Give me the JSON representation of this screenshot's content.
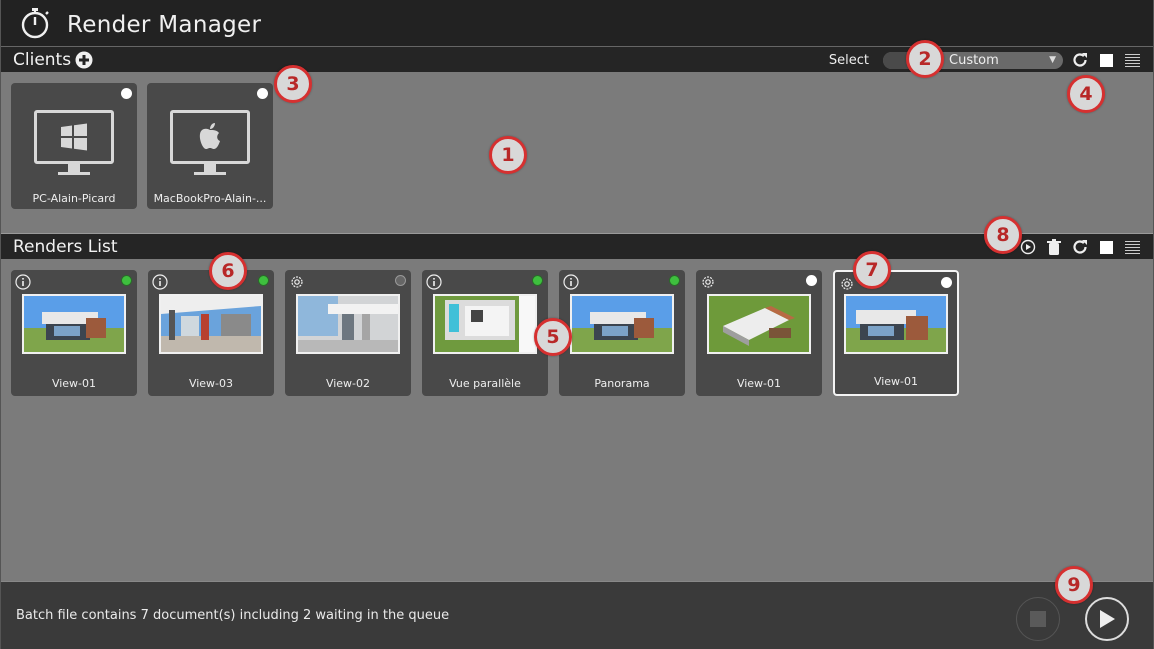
{
  "app": {
    "title": "Render Manager",
    "icon": "stopwatch-icon"
  },
  "clients": {
    "title": "Clients",
    "select_label": "Select",
    "select_value": "Custom",
    "items": [
      {
        "name": "PC-Alain-Picard",
        "os": "windows",
        "status": "white"
      },
      {
        "name": "MacBookPro-Alain-...",
        "os": "apple",
        "status": "white"
      }
    ]
  },
  "renders": {
    "title": "Renders List",
    "items": [
      {
        "name": "View-01",
        "icon": "info-icon",
        "status": "green",
        "selected": false
      },
      {
        "name": "View-03",
        "icon": "info-icon",
        "status": "green",
        "selected": false
      },
      {
        "name": "View-02",
        "icon": "gear-icon",
        "status": "grey",
        "selected": false
      },
      {
        "name": "Vue parallèle",
        "icon": "info-icon",
        "status": "green",
        "selected": false
      },
      {
        "name": "Panorama",
        "icon": "info-icon",
        "status": "green",
        "selected": false
      },
      {
        "name": "View-01",
        "icon": "gear-icon",
        "status": "white",
        "selected": false
      },
      {
        "name": "View-01",
        "icon": "gear-icon",
        "status": "white",
        "selected": true
      }
    ]
  },
  "status_bar": {
    "text": "Batch file contains 7 document(s) including 2 waiting in the queue"
  },
  "callouts": [
    "1",
    "2",
    "3",
    "4",
    "5",
    "6",
    "7",
    "8",
    "9"
  ],
  "colors": {
    "callout_border": "#d63030",
    "status_green": "#3ec03e",
    "panel_bg": "#7b7b7b",
    "bar_bg": "#252525"
  }
}
